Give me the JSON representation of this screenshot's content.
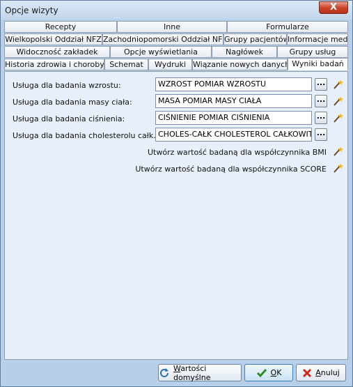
{
  "window": {
    "title": "Opcje wizyty",
    "close_label": "X"
  },
  "tabs": {
    "row1": [
      "Recepty",
      "Inne",
      "Formularze"
    ],
    "row2": [
      "Wielkopolski Oddział NFZ",
      "Zachodniopomorski Oddział NFZ",
      "Grupy pacjentów",
      "Informacje med."
    ],
    "row3": [
      "Widoczność zakładek",
      "Opcje wyświetlania",
      "Nagłówek",
      "Grupy usług"
    ],
    "row4": [
      "Historia zdrowia i choroby",
      "Schemat",
      "Wydruki",
      "Wiązanie nowych danych",
      "Wyniki badań"
    ],
    "active": "Wyniki badań"
  },
  "fields": [
    {
      "label": "Usługa dla badania wzrostu:",
      "value": "WZROST POMIAR WZROSTU",
      "browse": "..."
    },
    {
      "label": "Usługa dla badania masy ciała:",
      "value": "MASA POMIAR MASY CIAŁA",
      "browse": "..."
    },
    {
      "label": "Usługa dla badania ciśnienia:",
      "value": "CIŚNIENIE POMIAR CIŚNIENIA",
      "browse": "..."
    },
    {
      "label": "Usługa dla badania cholesterolu całk.:",
      "value": "CHOLES-CAŁK CHOLESTEROL CAŁKOWITY",
      "browse": "..."
    }
  ],
  "actions": {
    "bmi": "Utwórz wartość badaną dla współczynnika BMI",
    "score": "Utwórz wartość badaną dla współczynnika SCORE"
  },
  "buttons": {
    "defaults": {
      "underline": "W",
      "rest": "artości domyślne"
    },
    "ok": {
      "underline": "O",
      "rest": "K"
    },
    "cancel": {
      "underline": "A",
      "rest": "nuluj"
    }
  },
  "colors": {
    "accent": "#3c7fb1",
    "close": "#c9452c",
    "cancel_icon": "#d0281a",
    "ok_icon": "#2f8a2a"
  },
  "icons": [
    "wand-icon",
    "refresh-icon",
    "check-icon",
    "x-icon"
  ]
}
